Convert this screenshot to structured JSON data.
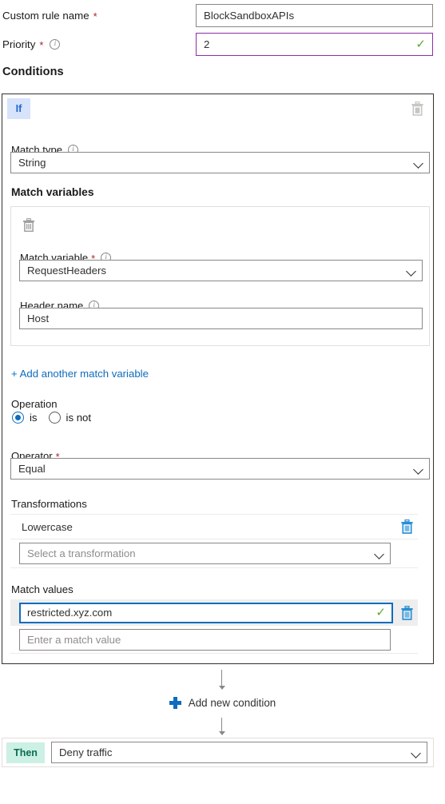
{
  "form": {
    "rule_name": {
      "label": "Custom rule name",
      "required": true,
      "value": "BlockSandboxAPIs"
    },
    "priority": {
      "label": "Priority",
      "required": true,
      "value": "2",
      "valid": true
    }
  },
  "conditions_title": "Conditions",
  "if_block": {
    "badge": "If",
    "delete_icon": "trash-icon",
    "match_type": {
      "label": "Match type",
      "value": "String",
      "has_info": true
    },
    "match_variables": {
      "title": "Match variables",
      "entries": [
        {
          "delete_icon": "trash-icon",
          "match_variable": {
            "label": "Match variable",
            "required": true,
            "has_info": true,
            "value": "RequestHeaders"
          },
          "header_name": {
            "label": "Header name",
            "has_info": true,
            "value": "Host"
          }
        }
      ],
      "add_link": "+ Add another match variable"
    },
    "operation": {
      "label": "Operation",
      "options": [
        {
          "label": "is",
          "selected": true
        },
        {
          "label": "is not",
          "selected": false
        }
      ]
    },
    "operator": {
      "label": "Operator",
      "required": true,
      "value": "Equal"
    },
    "transformations": {
      "title": "Transformations",
      "applied": [
        {
          "name": "Lowercase",
          "delete_icon": "trash-icon"
        }
      ],
      "select_placeholder": "Select a transformation"
    },
    "match_values": {
      "title": "Match values",
      "values": [
        {
          "value": "restricted.xyz.com",
          "valid": true,
          "focused": true,
          "delete_icon": "trash-icon"
        }
      ],
      "new_placeholder": "Enter a match value"
    }
  },
  "add_condition": {
    "label": "Add new condition",
    "icon": "plus-icon"
  },
  "then_block": {
    "badge": "Then",
    "action": "Deny traffic"
  },
  "colors": {
    "if_badge_bg": "#d6e3fb",
    "if_badge_text": "#2266cc",
    "then_badge_bg": "#ccf0e4",
    "then_badge_text": "#0b6b52",
    "link": "#0f6cbd",
    "required_star": "#a4262c",
    "valid_check": "#5aa832",
    "priority_border": "#8b2fa8",
    "focus_border": "#0f6cbd",
    "trash_active": "#4aa3df",
    "trash_disabled": "#c8c6c4"
  }
}
